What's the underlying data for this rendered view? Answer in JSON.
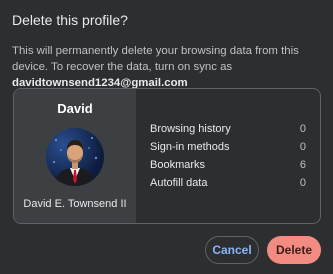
{
  "dialog": {
    "title": "Delete this profile?",
    "description_prefix": "This will permanently delete your browsing data from this device. To recover the data, turn on sync as ",
    "email": "davidtownsend1234@gmail.com"
  },
  "profile": {
    "name": "David",
    "full_name": "David E. Townsend II",
    "avatar": "profile-photo"
  },
  "stats": [
    {
      "label": "Browsing history",
      "count": "0"
    },
    {
      "label": "Sign-in methods",
      "count": "0"
    },
    {
      "label": "Bookmarks",
      "count": "6"
    },
    {
      "label": "Autofill data",
      "count": "0"
    }
  ],
  "buttons": {
    "cancel": "Cancel",
    "delete": "Delete"
  },
  "colors": {
    "accent": "#8ab4f8",
    "danger": "#f28b82",
    "background": "#2d2e30"
  }
}
